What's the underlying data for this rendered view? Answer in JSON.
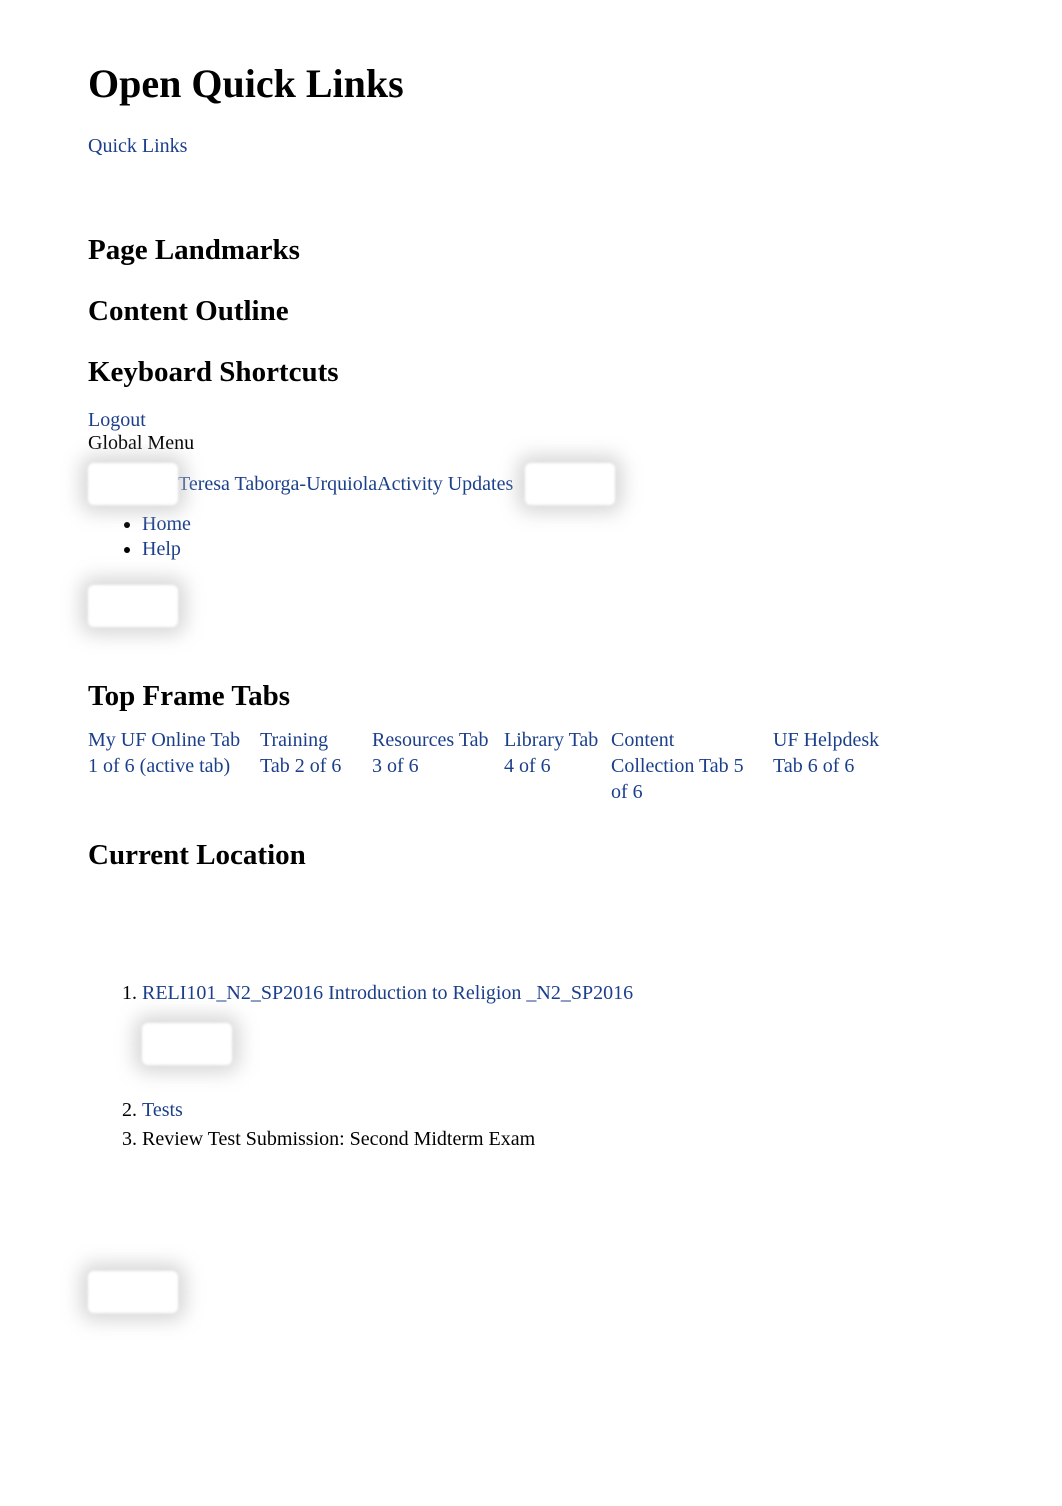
{
  "header": {
    "title": "Open Quick Links",
    "quick_links_label": "Quick Links"
  },
  "landmarks": {
    "page_landmarks": "Page Landmarks",
    "content_outline": "Content Outline",
    "keyboard_shortcuts": "Keyboard Shortcuts"
  },
  "auth": {
    "logout": "Logout",
    "global_menu": "Global Menu"
  },
  "user": {
    "name": "Teresa Taborga-Urquiola",
    "activity": "Activity Updates"
  },
  "global_links": {
    "home": "Home",
    "help": "Help"
  },
  "tabs_header": "Top Frame Tabs",
  "tabs": [
    {
      "label_line": "My UF Online Tab 1 of 6 (active tab)"
    },
    {
      "label_line": "Training Tab 2 of 6"
    },
    {
      "label_line": "Resources Tab 3 of 6"
    },
    {
      "label_line": "Library Tab 4 of 6"
    },
    {
      "label_line": "Content Collection Tab 5 of 6"
    },
    {
      "label_line": "UF Helpdesk Tab 6 of 6"
    }
  ],
  "location": {
    "header": "Current Location",
    "items": [
      {
        "text": "RELI101_N2_SP2016 Introduction to Religion _N2_SP2016",
        "link": true
      },
      {
        "text": "Tests",
        "link": true
      },
      {
        "text": "Review Test Submission: Second Midterm Exam",
        "link": false
      }
    ]
  }
}
